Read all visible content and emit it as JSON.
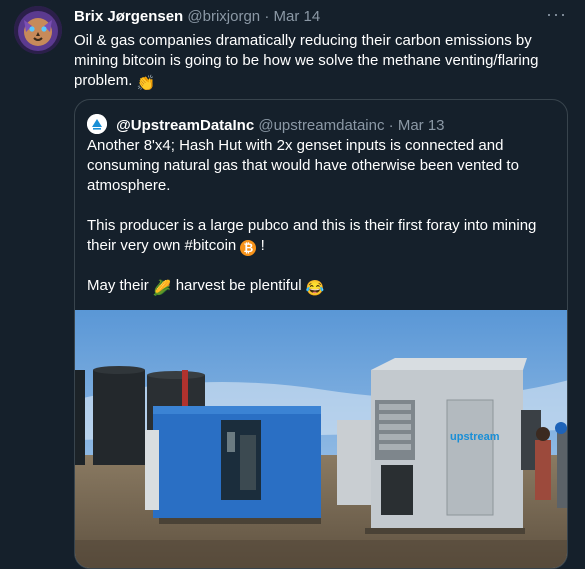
{
  "tweet": {
    "author_name": "Brix Jørgensen",
    "author_handle": "@brixjorgn",
    "separator": "·",
    "date": "Mar 14",
    "text": "Oil & gas companies dramatically reducing their carbon emissions by mining bitcoin is going to be how we solve the methane venting/flaring problem.",
    "text_emoji": "👏",
    "more_icon": "more-horizontal-icon"
  },
  "quote": {
    "author_name": "@UpstreamDataInc",
    "author_handle": "@upstreamdatainc",
    "separator": "·",
    "date": "Mar 13",
    "paragraph1": "Another 8'x4; Hash Hut with 2x genset inputs is connected and consuming natural gas that would have otherwise been vented to atmosphere.",
    "paragraph2_prefix": "This producer is a large pubco and this is their first foray into mining their very own #bitcoin",
    "paragraph2_emoji": "₿",
    "paragraph2_suffix": " !",
    "paragraph3_prefix": "May their",
    "paragraph3_emoji1": "🌽",
    "paragraph3_middle": "harvest be plentiful",
    "paragraph3_emoji2": "😂",
    "media_label": "upstream"
  },
  "colors": {
    "background": "#15202b",
    "muted_text": "#8b98a5",
    "border": "#38444d",
    "bitcoin_orange": "#f7931a"
  }
}
